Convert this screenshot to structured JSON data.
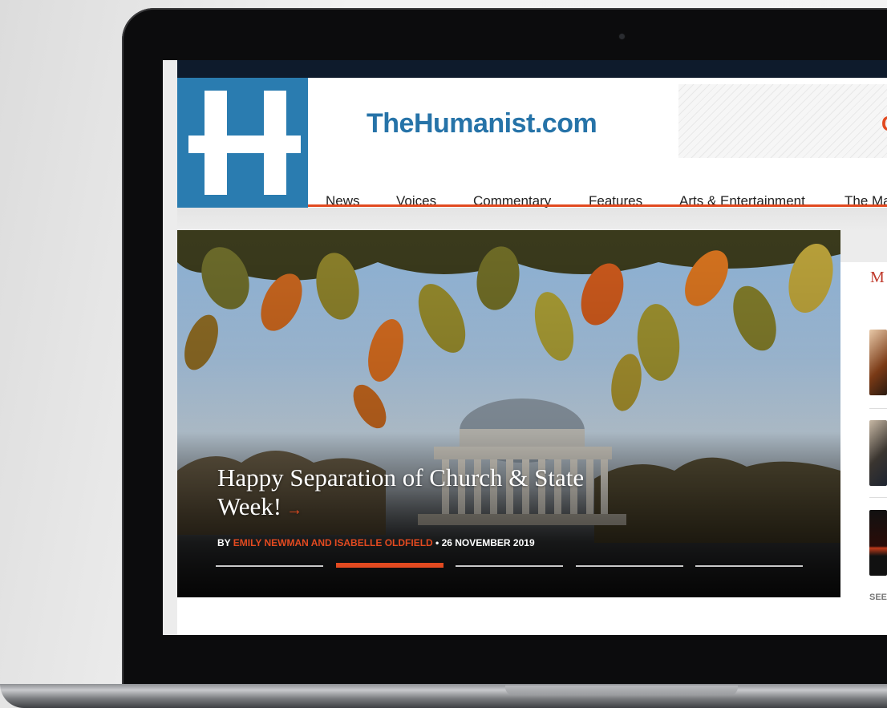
{
  "site": {
    "title": "TheHumanist.com",
    "accent_color": "#e24a20",
    "brand_color": "#2a7cb0"
  },
  "ad": {
    "glyph": "C"
  },
  "nav": {
    "items": [
      {
        "label": "News"
      },
      {
        "label": "Voices"
      },
      {
        "label": "Commentary"
      },
      {
        "label": "Features"
      },
      {
        "label": "Arts & Entertainment"
      },
      {
        "label": "The Ma"
      }
    ]
  },
  "hero": {
    "title": "Happy Separation of Church & State Week!",
    "arrow": "→",
    "byline_prefix": "BY ",
    "authors": "EMILY NEWMAN AND ISABELLE OLDFIELD",
    "date_sep": " • ",
    "date": "26 NOVEMBER 2019",
    "slides_total": 5,
    "active_slide": 2
  },
  "sidebar": {
    "heading": "M",
    "see_more": "SEE"
  }
}
